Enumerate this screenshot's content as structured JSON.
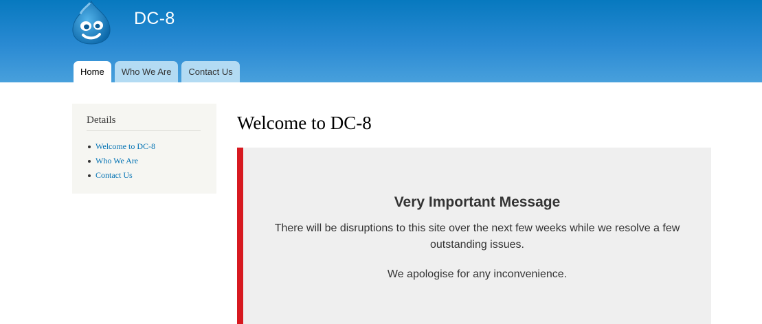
{
  "header": {
    "site_name": "DC-8",
    "colors": {
      "header_top": "#0779bf",
      "header_bottom": "#48a0dc",
      "tab": "#b3dbf3"
    },
    "logo_icon": "drupal-drop-logo"
  },
  "tabs": [
    {
      "label": "Home",
      "active": true
    },
    {
      "label": "Who We Are",
      "active": false
    },
    {
      "label": "Contact Us",
      "active": false
    }
  ],
  "sidebar": {
    "title": "Details",
    "links": [
      {
        "label": "Welcome to DC-8"
      },
      {
        "label": "Who We Are"
      },
      {
        "label": "Contact Us"
      }
    ]
  },
  "main": {
    "title": "Welcome to DC-8",
    "message": {
      "heading": "Very Important Message",
      "body": "There will be disruptions to this site over the next few weeks while we resolve a few outstanding issues.",
      "apology": "We apologise for any inconvenience.",
      "accent_color": "#d71920"
    }
  }
}
